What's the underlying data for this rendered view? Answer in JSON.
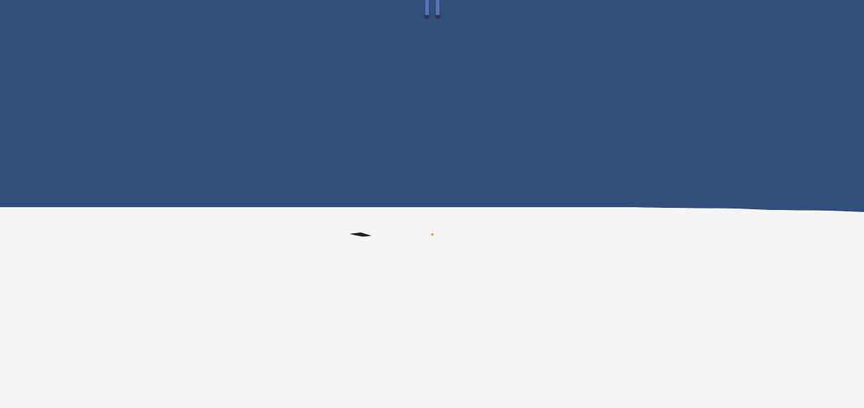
{
  "scene": {
    "sky_color": "#314f7b",
    "ground_color": "#f5f5f5",
    "character_leg_color": "#5f72b8",
    "character_shoe_color": "#2e3557",
    "shadow_color": "#1f1f1f",
    "pickup_color": "#e8a13a"
  },
  "icons": {
    "character": "player-feet-icon",
    "shadow": "shadow-icon",
    "pickup": "pickup-dot-icon"
  }
}
